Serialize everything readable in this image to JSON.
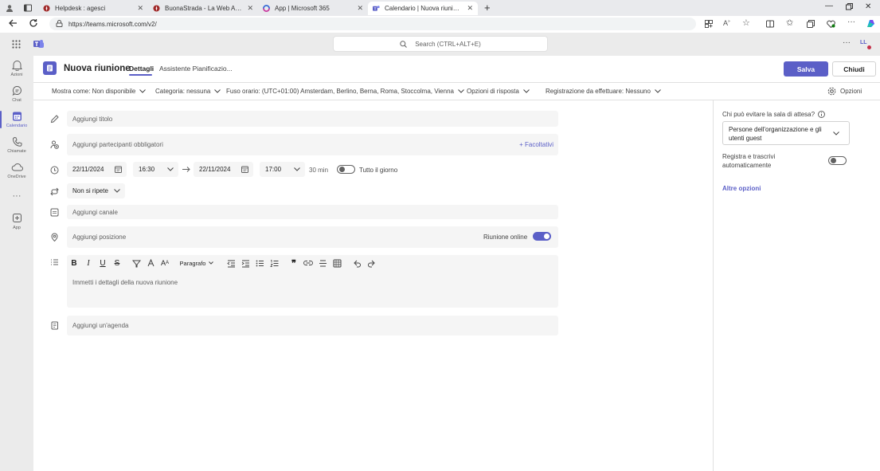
{
  "browser": {
    "tabs": [
      {
        "title": "Helpdesk : agesci",
        "active": false
      },
      {
        "title": "BuonaStrada - La Web Application",
        "active": false
      },
      {
        "title": "App | Microsoft 365",
        "active": false
      },
      {
        "title": "Calendario | Nuova riunione | Microsoft Teams",
        "active": true
      }
    ],
    "url": "https://teams.microsoft.com/v2/"
  },
  "teams": {
    "search_placeholder": "Search (CTRL+ALT+E)",
    "avatar_initials": "LL",
    "rail": [
      {
        "label": "Azioni",
        "icon": "bell-icon",
        "active": false
      },
      {
        "label": "Chat",
        "icon": "chat-icon",
        "active": false
      },
      {
        "label": "Calendario",
        "icon": "calendar-icon",
        "active": true
      },
      {
        "label": "Chiamate",
        "icon": "phone-icon",
        "active": false
      },
      {
        "label": "OneDrive",
        "icon": "cloud-icon",
        "active": false
      },
      {
        "label": "App",
        "icon": "add-app-icon",
        "active": false
      }
    ]
  },
  "meeting": {
    "title": "Nuova riunione",
    "tabs": [
      "Dettagli",
      "Assistente Pianificazio..."
    ],
    "save_label": "Salva",
    "close_label": "Chiudi",
    "options_bar": {
      "show_as": "Mostra come: Non disponibile",
      "category": "Categoria: nessuna",
      "timezone": "Fuso orario: (UTC+01:00) Amsterdam, Berlino, Berna, Roma, Stoccolma, Vienna",
      "response": "Opzioni di risposta",
      "recording": "Registrazione da effettuare: Nessuno",
      "options": "Opzioni"
    },
    "title_placeholder": "Aggiungi titolo",
    "attendees_placeholder": "Aggiungi partecipanti obbligatori",
    "optional_link": "+ Facoltativi",
    "start_date": "22/11/2024",
    "start_time": "16:30",
    "end_date": "22/11/2024",
    "end_time": "17:00",
    "duration": "30 min",
    "all_day_label": "Tutto il giorno",
    "repeat": "Non si ripete",
    "channel_placeholder": "Aggiungi canale",
    "location_placeholder": "Aggiungi posizione",
    "online_label": "Riunione online",
    "paragraph_label": "Paragrafo",
    "details_placeholder": "Immetti i dettagli della nuova riunione",
    "agenda_placeholder": "Aggiungi un'agenda"
  },
  "side_panel": {
    "lobby_label": "Chi può evitare la sala di attesa?",
    "lobby_value": "Persone dell'organizzazione e gli utenti guest",
    "record_label": "Registra e trascrivi automaticamente",
    "more_options": "Altre opzioni"
  },
  "colors": {
    "accent": "#5b5fc7",
    "rail_bg": "#ebebeb",
    "field_bg": "#f5f5f5"
  }
}
